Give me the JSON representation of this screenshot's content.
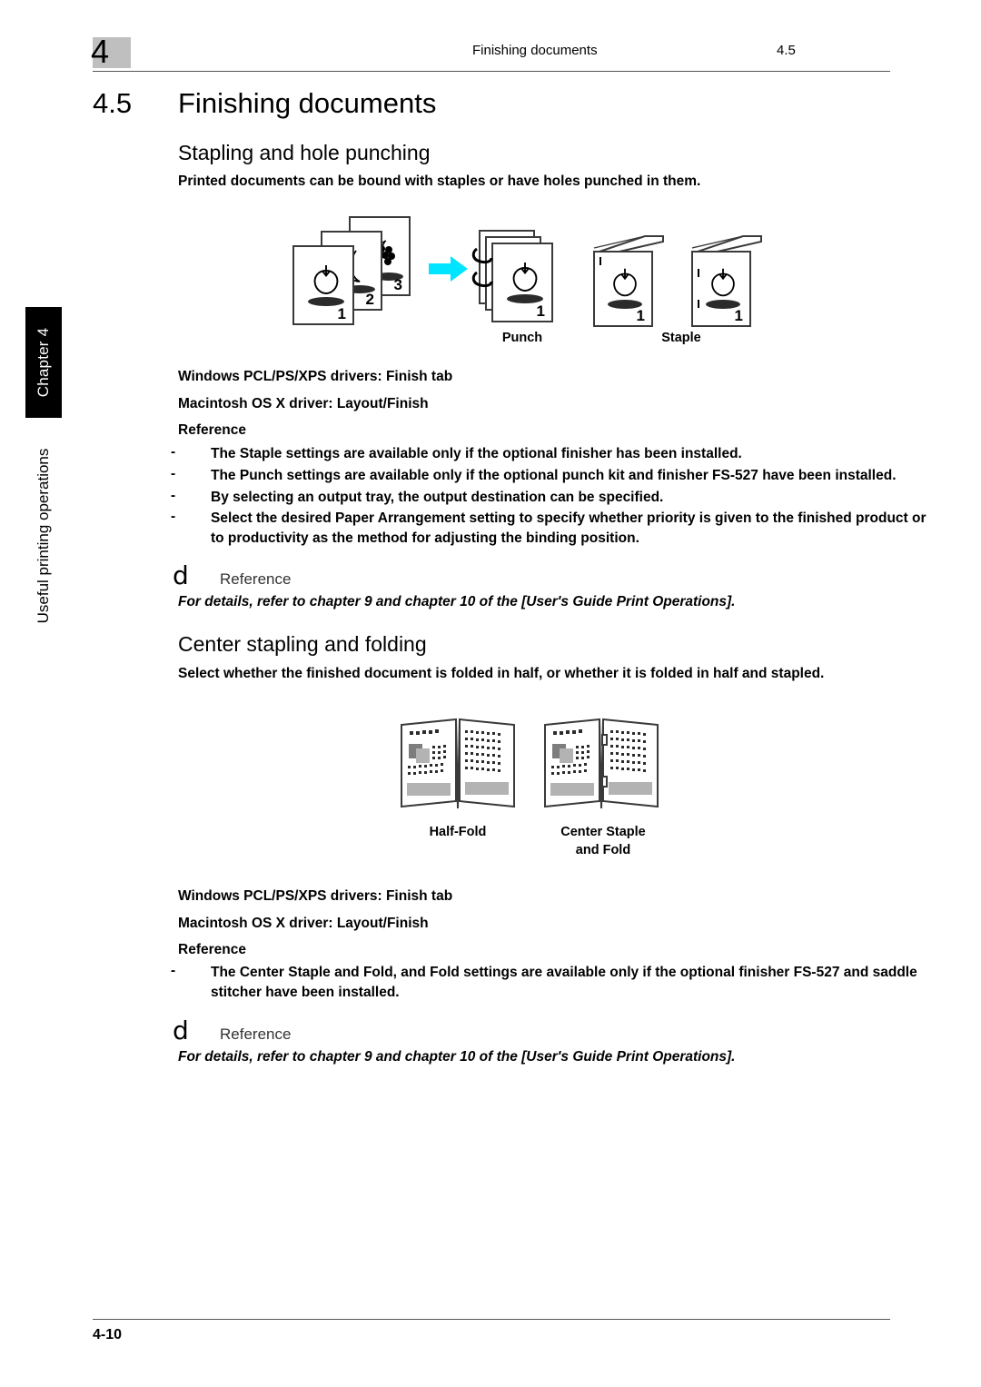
{
  "header": {
    "chapter_marker": "4",
    "running_title": "Finishing documents",
    "running_number": "4.5"
  },
  "sidebar": {
    "chapter_tab": "Chapter 4",
    "part_title": "Useful printing operations"
  },
  "section": {
    "number": "4.5",
    "title": "Finishing documents"
  },
  "subsection_1": {
    "heading": "Stapling and hole punching",
    "intro": "Printed documents can be bound with staples or have holes punched in them.",
    "figure": {
      "source_pages": [
        "1",
        "2",
        "3"
      ],
      "arrow_color": "#00e5ff",
      "results": [
        {
          "caption": "Punch",
          "page_number": "1"
        },
        {
          "caption": "Staple",
          "page_number": "1"
        }
      ]
    },
    "driver_line_windows": "Windows PCL/PS/XPS drivers: Finish tab",
    "driver_line_macintosh": "Macintosh OS X driver: Layout/Finish",
    "reference_label": "Reference",
    "notes": [
      "The Staple settings are available only if the optional finisher has been installed.",
      "The Punch settings are available only if the optional punch kit and finisher FS-527 have been installed.",
      "By selecting an output tray, the output destination can be specified.",
      "Select the desired Paper Arrangement setting to specify whether priority is given to the finished product or to productivity as the method for adjusting the binding position."
    ],
    "reference_box": {
      "icon": "book-reference-icon",
      "icon_glyph": "d",
      "title": "Reference",
      "detail": "For details, refer to chapter 9 and chapter 10 of the [User's Guide Print Operations]."
    }
  },
  "subsection_2": {
    "heading": "Center stapling and folding",
    "intro": "Select whether the finished document is folded in half, or whether it is folded in half and stapled.",
    "figure": {
      "items": [
        {
          "caption_line1": "Half-Fold",
          "caption_line2": ""
        },
        {
          "caption_line1": "Center Staple",
          "caption_line2": "and Fold"
        }
      ]
    },
    "driver_line_windows": "Windows PCL/PS/XPS drivers: Finish tab",
    "driver_line_macintosh": "Macintosh OS X driver: Layout/Finish",
    "reference_label": "Reference",
    "notes": [
      "The Center Staple and Fold, and Fold settings are available only if the optional finisher FS-527 and saddle stitcher have been installed."
    ],
    "reference_box": {
      "icon": "book-reference-icon",
      "icon_glyph": "d",
      "title": "Reference",
      "detail": "For details, refer to chapter 9 and chapter 10 of the [User's Guide Print Operations]."
    }
  },
  "bullet_dash": "-",
  "footer": {
    "page_number": "4-10"
  }
}
